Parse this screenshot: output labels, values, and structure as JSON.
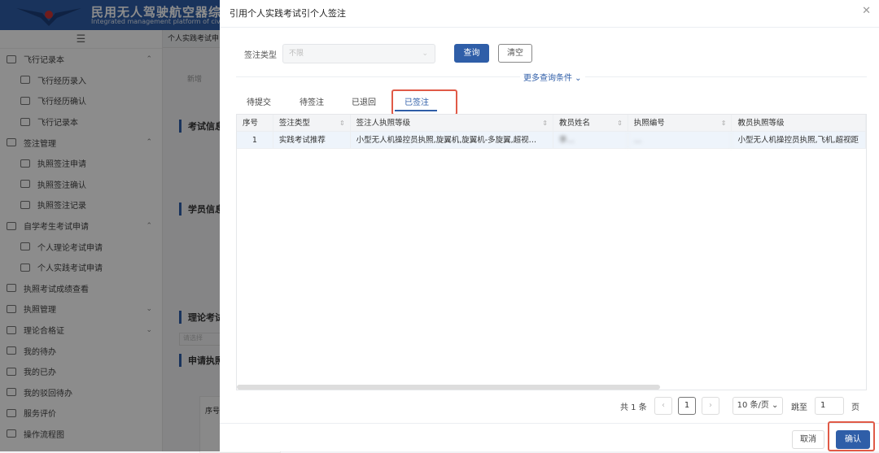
{
  "app": {
    "title": "民用无人驾驶航空器综合管",
    "subtitle": "Integrated management platform of civ"
  },
  "sidebar": {
    "items": [
      {
        "label": "飞行记录本",
        "level": 1,
        "chevron": "up"
      },
      {
        "label": "飞行经历录入",
        "level": 2
      },
      {
        "label": "飞行经历确认",
        "level": 2
      },
      {
        "label": "飞行记录本",
        "level": 2
      },
      {
        "label": "签注管理",
        "level": 1,
        "chevron": "up"
      },
      {
        "label": "执照签注申请",
        "level": 2
      },
      {
        "label": "执照签注确认",
        "level": 2
      },
      {
        "label": "执照签注记录",
        "level": 2
      },
      {
        "label": "自学考生考试申请",
        "level": 1,
        "chevron": "up"
      },
      {
        "label": "个人理论考试申请",
        "level": 2
      },
      {
        "label": "个人实践考试申请",
        "level": 2
      },
      {
        "label": "执照考试成绩查看",
        "level": 1
      },
      {
        "label": "执照管理",
        "level": 1,
        "chevron": "down"
      },
      {
        "label": "理论合格证",
        "level": 1,
        "chevron": "down"
      },
      {
        "label": "我的待办",
        "level": 1
      },
      {
        "label": "我的已办",
        "level": 1
      },
      {
        "label": "我的驳回待办",
        "level": 1
      },
      {
        "label": "服务评价",
        "level": 1
      },
      {
        "label": "操作流程图",
        "level": 1
      }
    ]
  },
  "main": {
    "breadcrumb": "个人实践考试申",
    "new_label": "新增",
    "sections": [
      "考试信息",
      "学员信息",
      "理论考试",
      "申请执照"
    ],
    "input_placeholder": "请选择",
    "table_header": "序号"
  },
  "modal": {
    "title": "引用个人实践考试引个人签注",
    "filter": {
      "label": "签注类型",
      "placeholder": "不限",
      "query": "查询",
      "clear": "清空",
      "more": "更多查询条件 ⌄"
    },
    "tabs": [
      {
        "label": "待提交"
      },
      {
        "label": "待签注"
      },
      {
        "label": "已退回"
      },
      {
        "label": "已签注",
        "active": true
      }
    ],
    "table": {
      "columns": [
        "序号",
        "签注类型",
        "签注人执照等级",
        "教员姓名",
        "执照编号",
        "教员执照等级"
      ],
      "rows": [
        [
          "1",
          "实践考试推荐",
          "小型无人机操控员执照,旋翼机,旋翼机-多旋翼,超视…",
          "李…",
          "…",
          "小型无人机操控员执照,飞机,超视距"
        ]
      ]
    },
    "pager": {
      "total": "共 1 条",
      "page": "1",
      "size": "10 条/页 ⌄",
      "jump": "跳至",
      "jump_value": "1",
      "page_unit": "页"
    },
    "cancel": "取消",
    "confirm": "确认"
  },
  "colors": {
    "primary": "#2f5ea8",
    "highlight": "#e05a47"
  }
}
